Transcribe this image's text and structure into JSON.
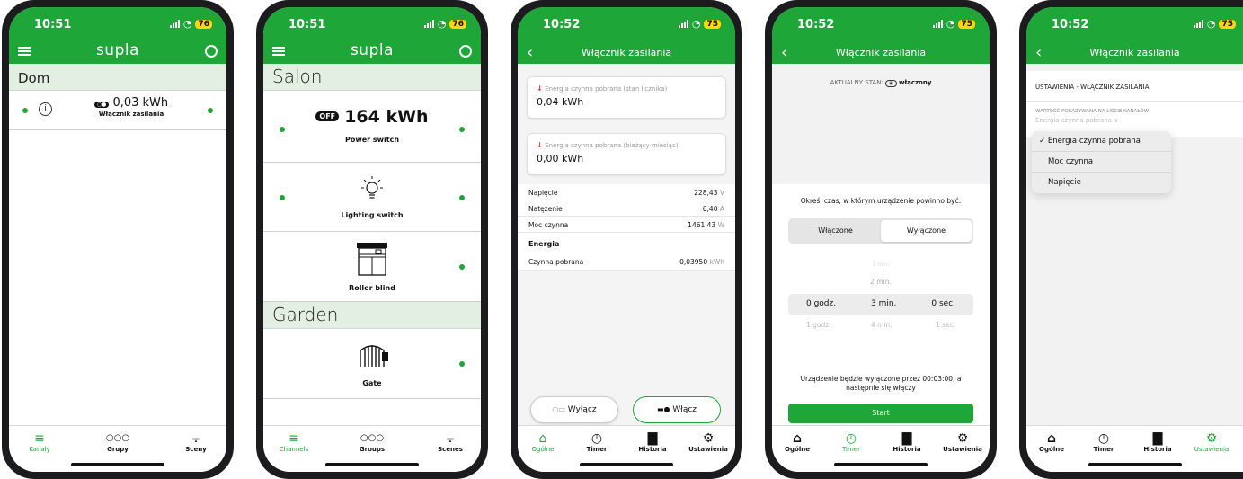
{
  "status": {
    "p1_time": "10:51",
    "p2_time": "10:51",
    "p3_time": "10:52",
    "p4_time": "10:52",
    "p5_time": "10:52",
    "battery_76": "76",
    "battery_75": "75"
  },
  "p1": {
    "logo": "supla",
    "location": "Dom",
    "channel_value": "0,03 kWh",
    "channel_name": "Włącznik zasilania",
    "nav": [
      "Kanały",
      "Grupy",
      "Sceny"
    ]
  },
  "p2": {
    "logo": "supla",
    "loc1": "Salon",
    "loc2": "Garden",
    "toggle_off": "OFF",
    "power_value": "164 kWh",
    "ch1": "Power switch",
    "ch2": "Lighting switch",
    "ch3": "Roller blind",
    "ch4": "Gate",
    "nav": [
      "Channels",
      "Groups",
      "Scenes"
    ]
  },
  "p3": {
    "title": "Włącznik zasilania",
    "card1_label": "Energia czynna pobrana (stan licznika)",
    "card1_value": "0,04 kWh",
    "card2_label": "Energia czynna pobrana (bieżący miesiąc)",
    "card2_value": "0,00 kWh",
    "rows": [
      {
        "label": "Napięcie",
        "value": "228,43",
        "unit": "V"
      },
      {
        "label": "Natężenie",
        "value": "6,40",
        "unit": "A"
      },
      {
        "label": "Moc czynna",
        "value": "1461,43",
        "unit": "W"
      }
    ],
    "energy_header": "Energia",
    "energy_row": {
      "label": "Czynna pobrana",
      "value": "0,03950",
      "unit": "kWh"
    },
    "btn_off": "Wyłącz",
    "btn_on": "Włącz",
    "nav": [
      "Ogólne",
      "Timer",
      "Historia",
      "Ustawienia"
    ]
  },
  "p4": {
    "title": "Włącznik zasilania",
    "state_label": "AKTUALNY STAN:",
    "state_value": "włączony",
    "prompt": "Określ czas, w którym urządzenie powinno być:",
    "seg_on": "Włączone",
    "seg_off": "Wyłączone",
    "picker_above2": "1 min.",
    "picker_above": "2 min.",
    "picker_h": "0 godz.",
    "picker_m": "3 min.",
    "picker_s": "0 sec.",
    "picker_below_h": "1 godz.",
    "picker_below_m": "4 min.",
    "picker_below_s": "1 sec.",
    "summary": "Urządzenie będzie wyłączone przez 00:03:00, a następnie się włączy",
    "start": "Start",
    "nav": [
      "Ogólne",
      "Timer",
      "Historia",
      "Ustawienia"
    ]
  },
  "p5": {
    "title": "Włącznik zasilania",
    "header": "USTAWIENIA - WŁĄCZNIK ZASILANIA",
    "field_label": "WARTOŚĆ POKAZYWANA NA LIŚCIE KANAŁÓW",
    "field_value": "Energia czynna pobrana",
    "options": [
      "Energia czynna pobrana",
      "Moc czynna",
      "Napięcie"
    ],
    "nav": [
      "Ogólne",
      "Timer",
      "Historia",
      "Ustawienia"
    ]
  },
  "colors": {
    "brand_green": "#1ea638",
    "section_bg": "#e2efe2",
    "battery": "#ffd60a"
  }
}
